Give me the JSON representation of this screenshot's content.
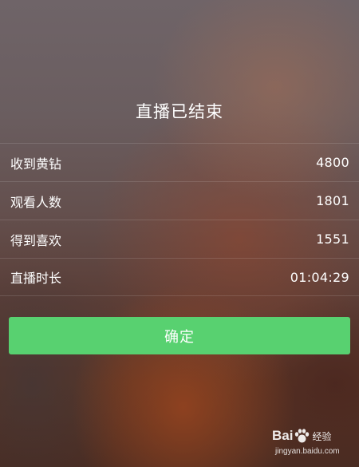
{
  "title": "直播已结束",
  "stats": [
    {
      "label": "收到黄钻",
      "value": "4800"
    },
    {
      "label": "观看人数",
      "value": "1801"
    },
    {
      "label": "得到喜欢",
      "value": "1551"
    },
    {
      "label": "直播时长",
      "value": "01:04:29"
    }
  ],
  "confirm_label": "确定",
  "colors": {
    "confirm_button": "#58d170",
    "text": "#ffffff"
  },
  "watermark": {
    "brand_left": "Bai",
    "brand_right": "经验",
    "url": "jingyan.baidu.com"
  }
}
